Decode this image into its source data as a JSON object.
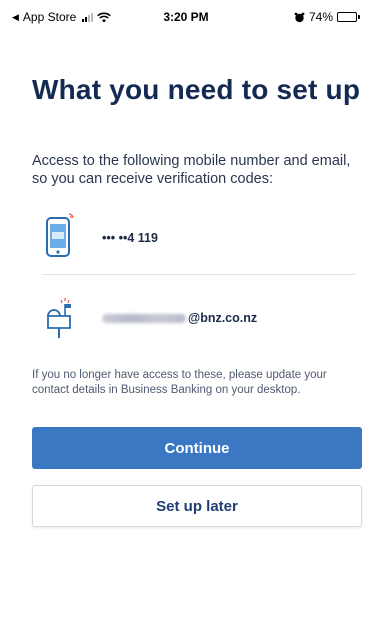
{
  "status_bar": {
    "back_label": "App Store",
    "time": "3:20 PM",
    "battery": "74%",
    "battery_level": 0.74,
    "icons": [
      "signal-icon",
      "wifi-icon",
      "alarm-icon",
      "battery-icon"
    ]
  },
  "page": {
    "title": "What you need to set up",
    "intro": "Access to the following mobile number and email, so you can receive verification codes:",
    "phone": {
      "icon": "mobile-phone-icon",
      "value": "••• ••4 119"
    },
    "email": {
      "icon": "mailbox-icon",
      "visible_domain": "@bnz.co.nz"
    },
    "note": "If you no longer have access to these, please update your contact details in Business Banking on your desktop."
  },
  "buttons": {
    "continue_label": "Continue",
    "later_label": "Set up later"
  },
  "colors": {
    "primary": "#3b78c3",
    "title": "#142a52",
    "secondary_text": "#1f3f73"
  }
}
